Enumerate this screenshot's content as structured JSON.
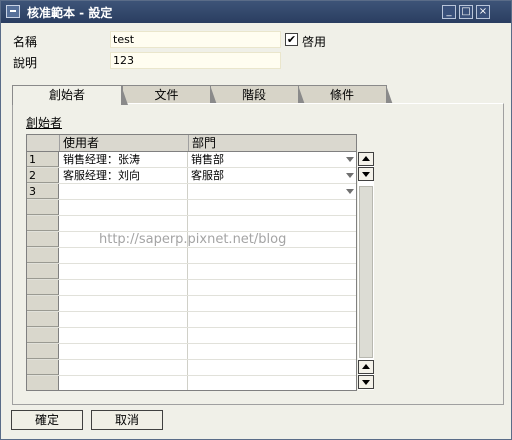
{
  "window": {
    "title": "核准範本 - 設定"
  },
  "form": {
    "name_label": "名稱",
    "name_value": "test",
    "enabled_label": "啓用",
    "enabled_checked": true,
    "enabled_mark": "✔",
    "desc_label": "說明",
    "desc_value": "123"
  },
  "tabs": [
    {
      "label": "創始者",
      "active": true
    },
    {
      "label": "文件",
      "active": false
    },
    {
      "label": "階段",
      "active": false
    },
    {
      "label": "條件",
      "active": false
    }
  ],
  "section_title": "創始者",
  "grid": {
    "columns": [
      "使用者",
      "部門"
    ],
    "rows": [
      {
        "num": "1",
        "user": "销售经理：张涛",
        "dept": "销售部"
      },
      {
        "num": "2",
        "user": "客服经理：刘向",
        "dept": "客服部"
      },
      {
        "num": "3",
        "user": "",
        "dept": ""
      }
    ],
    "empty_rows": 12
  },
  "watermark": "http://saperp.pixnet.net/blog",
  "buttons": {
    "ok": "確定",
    "cancel": "取消"
  },
  "colors": {
    "titlebar": "#2f466c",
    "background": "#f0f0e8",
    "field_bg": "#fffdf0"
  }
}
